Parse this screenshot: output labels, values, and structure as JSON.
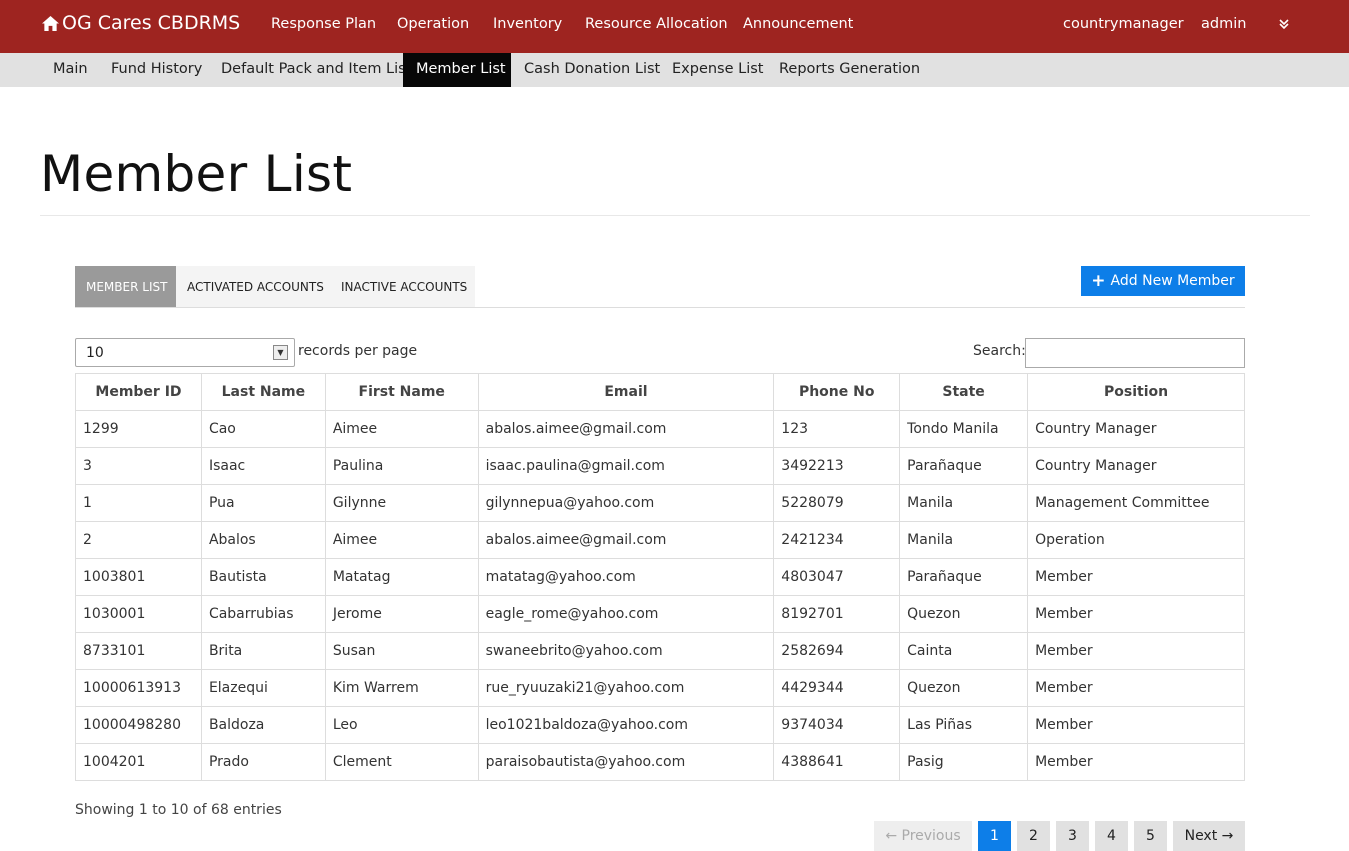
{
  "nav": {
    "brand": "OG Cares CBDRMS",
    "items": [
      "Response Plan",
      "Operation",
      "Inventory",
      "Resource Allocation",
      "Announcement"
    ],
    "user": "countrymanager",
    "role": "admin",
    "dropdown_icon": "double-chevron-down-icon"
  },
  "subnav": {
    "items": [
      "Main",
      "Fund History",
      "Default Pack and Item List",
      "Member List",
      "Cash Donation List",
      "Expense List",
      "Reports Generation"
    ],
    "active": "Member List"
  },
  "page": {
    "title": "Member List"
  },
  "tabs": {
    "items": [
      "MEMBER LIST",
      "ACTIVATED ACCOUNTS",
      "INACTIVE ACCOUNTS"
    ],
    "active": "MEMBER LIST"
  },
  "add_button": {
    "label": "Add New Member",
    "icon": "plus-icon"
  },
  "length": {
    "value": "10",
    "label": "records per page"
  },
  "search": {
    "label": "Search:",
    "value": ""
  },
  "table": {
    "headers": [
      "Member ID",
      "Last Name",
      "First Name",
      "Email",
      "Phone No",
      "State",
      "Position"
    ],
    "rows": [
      [
        "1299",
        "Cao",
        "Aimee",
        "abalos.aimee@gmail.com",
        "123",
        "Tondo Manila",
        "Country Manager"
      ],
      [
        "3",
        "Isaac",
        "Paulina",
        "isaac.paulina@gmail.com",
        "3492213",
        "Parañaque",
        "Country Manager"
      ],
      [
        "1",
        "Pua",
        "Gilynne",
        "gilynnepua@yahoo.com",
        "5228079",
        "Manila",
        "Management Committee"
      ],
      [
        "2",
        "Abalos",
        "Aimee",
        "abalos.aimee@gmail.com",
        "2421234",
        "Manila",
        "Operation"
      ],
      [
        "1003801",
        "Bautista",
        "Matatag",
        "matatag@yahoo.com",
        "4803047",
        "Parañaque",
        "Member"
      ],
      [
        "1030001",
        "Cabarrubias",
        "Jerome",
        "eagle_rome@yahoo.com",
        "8192701",
        "Quezon",
        "Member"
      ],
      [
        "8733101",
        "Brita",
        "Susan",
        "swaneebrito@yahoo.com",
        "2582694",
        "Cainta",
        "Member"
      ],
      [
        "10000613913",
        "Elazequi",
        "Kim Warrem",
        "rue_ryuuzaki21@yahoo.com",
        "4429344",
        "Quezon",
        "Member"
      ],
      [
        "10000498280",
        "Baldoza",
        "Leo",
        "leo1021baldoza@yahoo.com",
        "9374034",
        "Las Piñas",
        "Member"
      ],
      [
        "1004201",
        "Prado",
        "Clement",
        "paraisobautista@yahoo.com",
        "4388641",
        "Pasig",
        "Member"
      ]
    ]
  },
  "info": "Showing 1 to 10 of 68 entries",
  "pagination": {
    "previous": "← Previous",
    "pages": [
      "1",
      "2",
      "3",
      "4",
      "5"
    ],
    "active": "1",
    "next": "Next →"
  },
  "colors": {
    "navbar": "#9e2420",
    "accent": "#0d7ee8",
    "subnav": "#e1e1e1"
  }
}
